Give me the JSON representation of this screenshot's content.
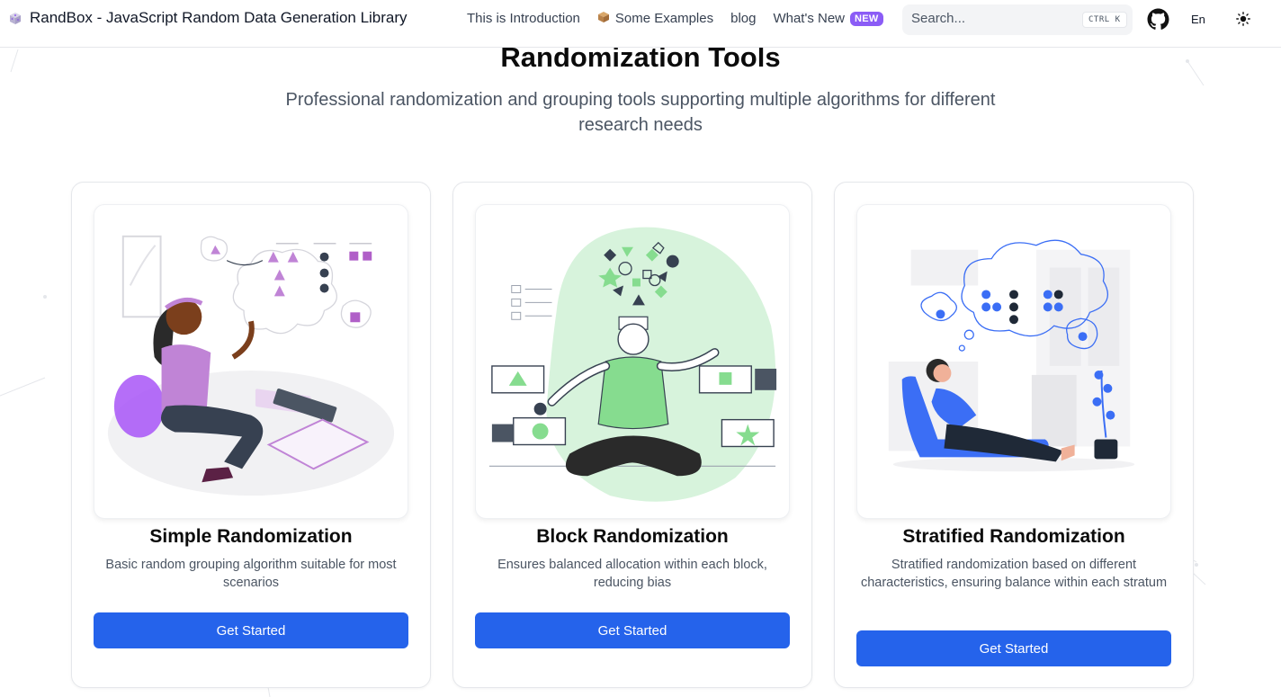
{
  "header": {
    "brand_title": "RandBox - JavaScript Random Data Generation Library",
    "nav": [
      {
        "label": "This is Introduction"
      },
      {
        "label": "Some Examples"
      },
      {
        "label": "blog"
      },
      {
        "label": "What's New",
        "badge": "NEW"
      }
    ],
    "search_placeholder": "Search...",
    "search_shortcut": "CTRL K",
    "language": "En"
  },
  "hero": {
    "title": "Randomization Tools",
    "subtitle": "Professional randomization and grouping tools supporting multiple algorithms for different research needs"
  },
  "cards": [
    {
      "title": "Simple Randomization",
      "description": "Basic random grouping algorithm suitable for most scenarios",
      "button": "Get Started",
      "illustration": "woman-thinking-shapes-illustration"
    },
    {
      "title": "Block Randomization",
      "description": "Ensures balanced allocation within each block, reducing bias",
      "button": "Get Started",
      "illustration": "man-meditating-shapes-illustration"
    },
    {
      "title": "Stratified Randomization",
      "description": "Stratified randomization based on different characteristics, ensuring balance within each stratum",
      "button": "Get Started",
      "illustration": "woman-relaxing-thinking-illustration"
    }
  ],
  "colors": {
    "primary_button": "#2563eb",
    "badge": "#8b5cf6",
    "purple_accent": "#c084d6",
    "green_accent": "#86dc8f",
    "blue_accent": "#3b6ef5"
  }
}
